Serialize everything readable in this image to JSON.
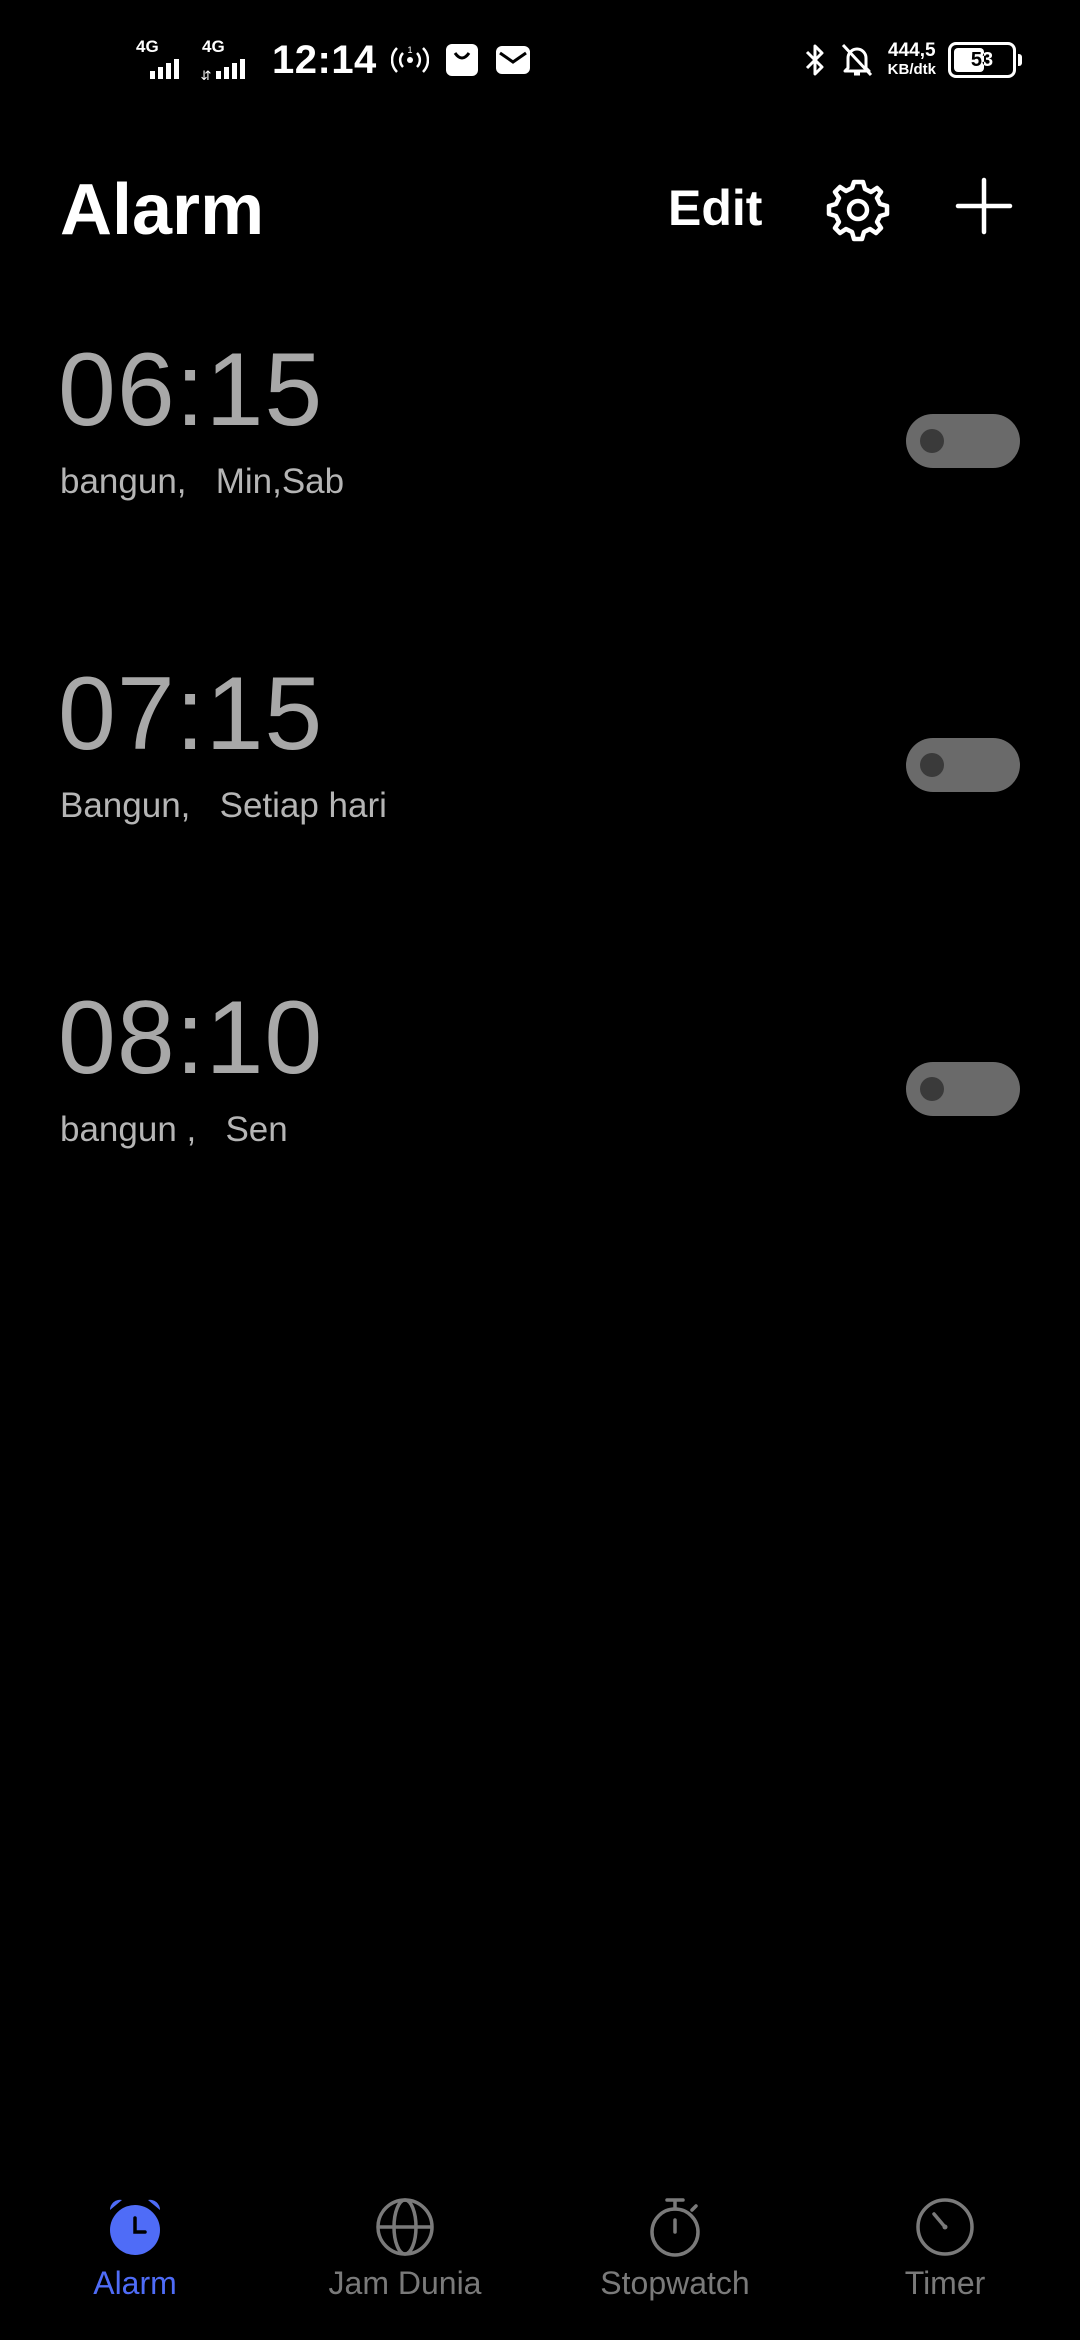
{
  "status_bar": {
    "sim1_network": "4G",
    "sim2_network": "4G",
    "time": "12:14",
    "net_speed_value": "444,5",
    "net_speed_unit": "KB/dtk",
    "battery_level": "53",
    "icons": [
      "hotspot-icon",
      "shopping-bag-icon",
      "mail-icon",
      "bluetooth-icon",
      "alarm-off-icon"
    ]
  },
  "header": {
    "title": "Alarm",
    "edit_label": "Edit",
    "settings_icon": "gear-icon",
    "add_icon": "plus-icon"
  },
  "alarms": [
    {
      "time": "06:15",
      "label": "bangun,",
      "repeat": "Min,Sab",
      "enabled": false
    },
    {
      "time": "07:15",
      "label": "Bangun,",
      "repeat": "Setiap hari",
      "enabled": false
    },
    {
      "time": "08:10",
      "label": "bangun ,",
      "repeat": "Sen",
      "enabled": false
    }
  ],
  "bottom_nav": {
    "tabs": [
      {
        "label": "Alarm",
        "icon": "alarm-clock-icon",
        "active": true
      },
      {
        "label": "Jam Dunia",
        "icon": "globe-icon",
        "active": false
      },
      {
        "label": "Stopwatch",
        "icon": "stopwatch-icon",
        "active": false
      },
      {
        "label": "Timer",
        "icon": "timer-icon",
        "active": false
      }
    ]
  },
  "colors": {
    "background": "#000000",
    "accent": "#4f6cf7",
    "time_text": "#a8a8a8",
    "toggle_off": "#6a6a6a",
    "inactive_nav": "#7a7a7a"
  }
}
